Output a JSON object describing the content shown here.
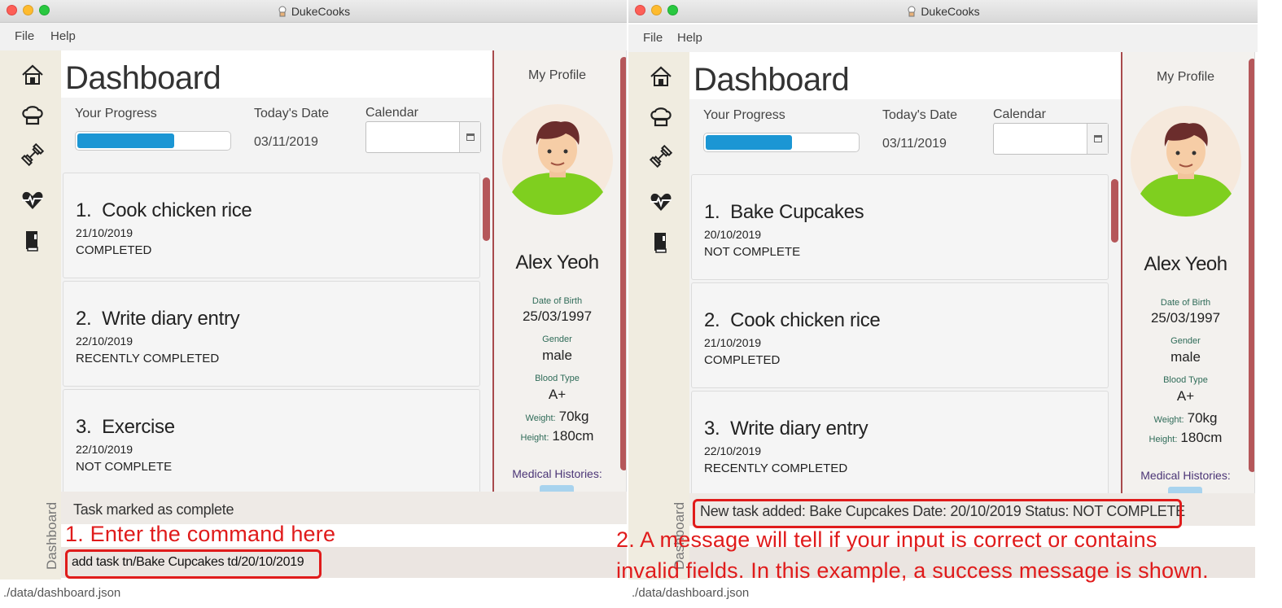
{
  "app_title": "DukeCooks",
  "menu": {
    "file": "File",
    "help": "Help"
  },
  "nav_icons": [
    "home-icon",
    "chef-hat-icon",
    "dumbbell-icon",
    "heartbeat-icon",
    "book-icon"
  ],
  "sidebar_label": "Dashboard",
  "status_path": "./data/dashboard.json",
  "colors": {
    "accent": "#1b96d4",
    "scroll": "#b5575a",
    "profile_border": "#a84a4c",
    "annotation": "#e01b1b"
  },
  "left": {
    "dashboard": {
      "title": "Dashboard",
      "progress_label": "Your Progress",
      "progress_fraction": 0.65,
      "date_label": "Today's Date",
      "date_value": "03/11/2019",
      "calendar_label": "Calendar"
    },
    "tasks": [
      {
        "num": "1.",
        "name": "Cook chicken rice",
        "date": "21/10/2019",
        "status": "COMPLETED"
      },
      {
        "num": "2.",
        "name": "Write diary entry",
        "date": "22/10/2019",
        "status": "RECENTLY COMPLETED"
      },
      {
        "num": "3.",
        "name": "Exercise",
        "date": "22/10/2019",
        "status": "NOT COMPLETE"
      }
    ],
    "result": "Task marked as complete",
    "command": "add task tn/Bake Cupcakes td/20/10/2019",
    "annotation": "1. Enter the command here"
  },
  "right": {
    "dashboard": {
      "title": "Dashboard",
      "progress_label": "Your Progress",
      "progress_fraction": 0.58,
      "date_label": "Today's Date",
      "date_value": "03/11/2019",
      "calendar_label": "Calendar"
    },
    "tasks": [
      {
        "num": "1.",
        "name": "Bake Cupcakes",
        "date": "20/10/2019",
        "status": "NOT COMPLETE"
      },
      {
        "num": "2.",
        "name": "Cook chicken rice",
        "date": "21/10/2019",
        "status": "COMPLETED"
      },
      {
        "num": "3.",
        "name": "Write diary entry",
        "date": "22/10/2019",
        "status": "RECENTLY COMPLETED"
      }
    ],
    "result": "New task added: Bake Cupcakes Date: 20/10/2019 Status: NOT COMPLETE",
    "command": "",
    "annotation_line1": "2. A message will tell if your input is correct or contains",
    "annotation_line2": "invalid fields. In this example, a success message is shown."
  },
  "profile": {
    "title": "My Profile",
    "name": "Alex Yeoh",
    "dob_label": "Date of Birth",
    "dob": "25/03/1997",
    "gender_label": "Gender",
    "gender": "male",
    "blood_label": "Blood Type",
    "blood": "A+",
    "weight_label": "Weight:",
    "weight": "70kg",
    "height_label": "Height:",
    "height": "180cm",
    "medical_label": "Medical Histories:"
  }
}
